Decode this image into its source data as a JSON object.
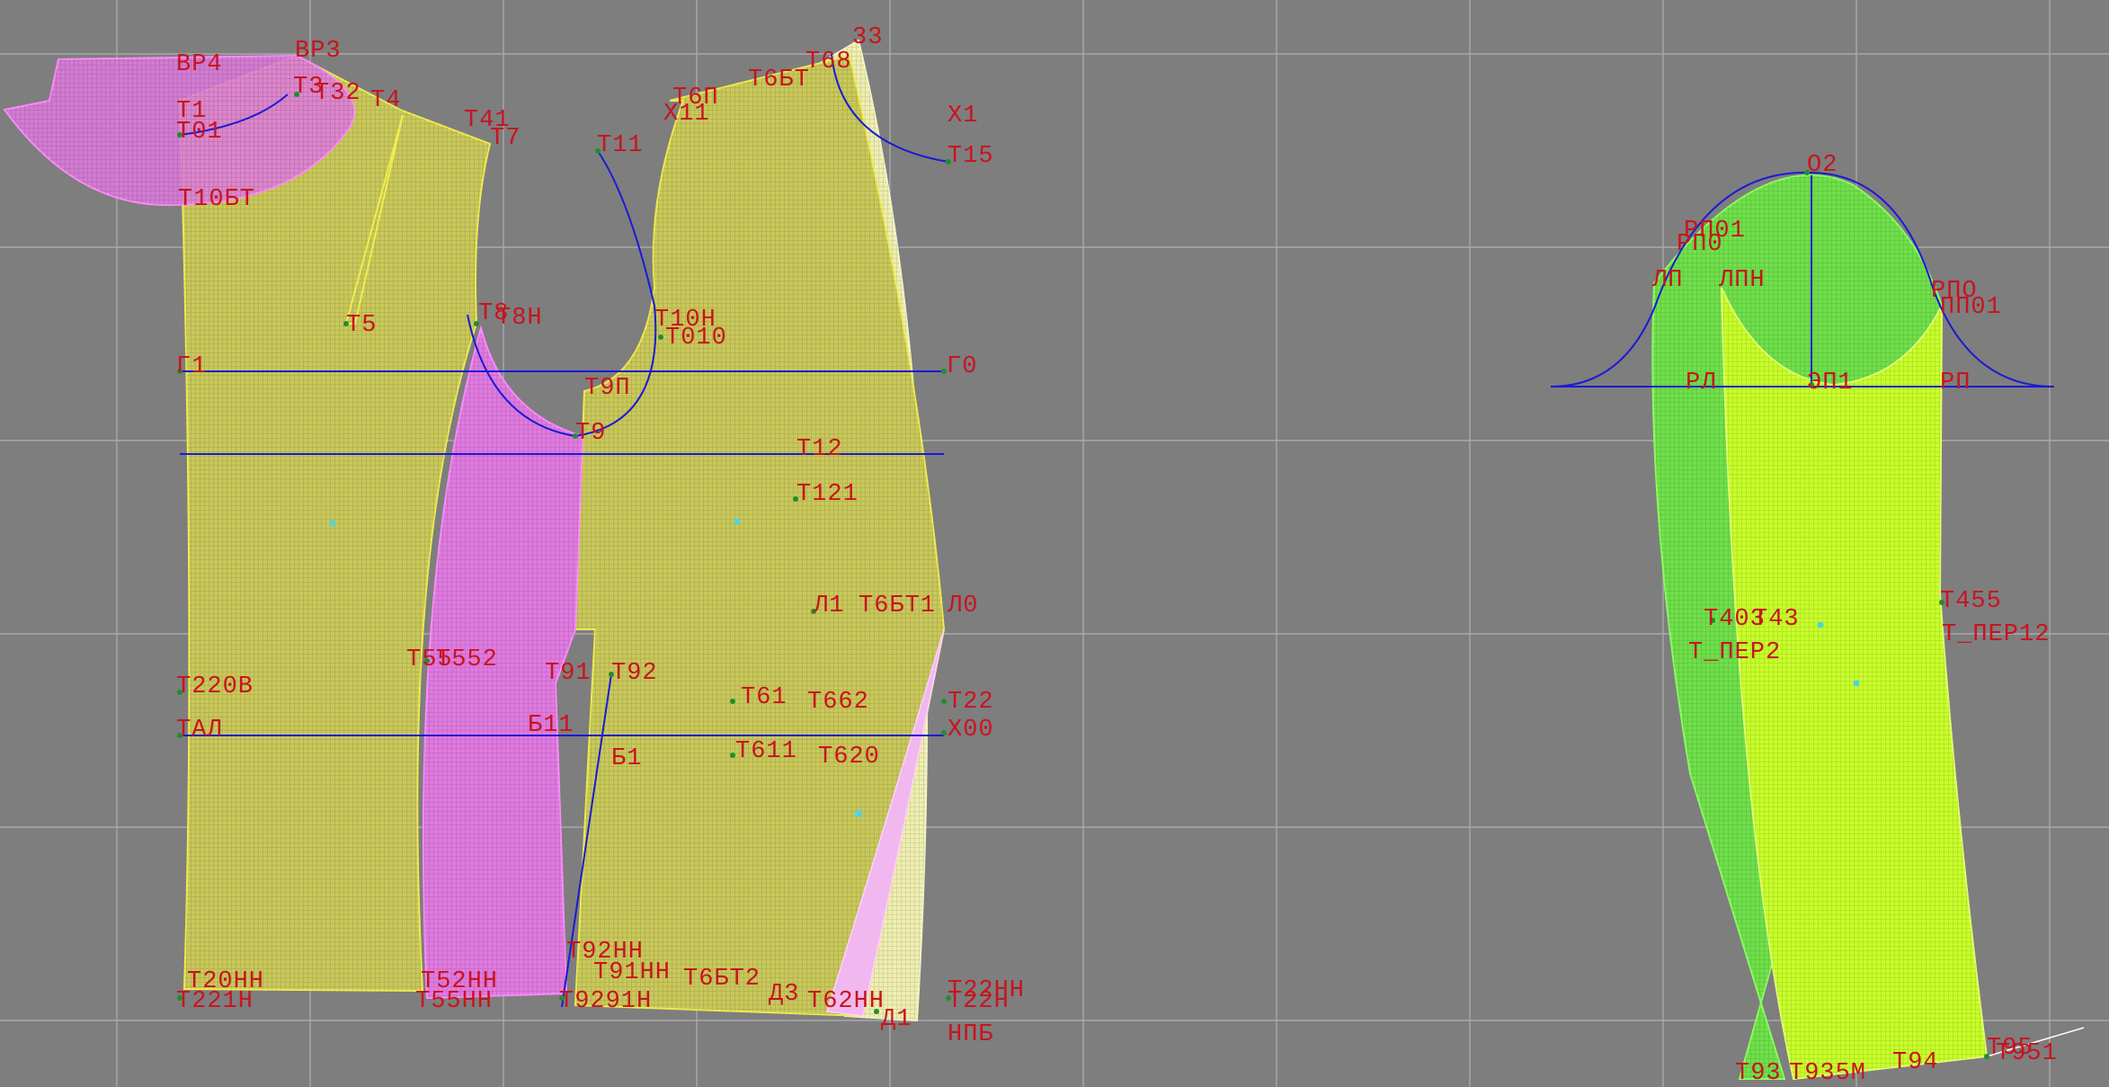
{
  "colors": {
    "background": "#7e7e7e",
    "grid": "#a9a9a9",
    "label": "#c8141e",
    "construction_line": "#1a1ad6",
    "piece_yellow": "#c9c85a",
    "piece_pink": "#e07ae0",
    "piece_pale": "#ecec9e",
    "piece_green": "#6fe04a",
    "piece_lime": "#c8ff2a"
  },
  "labels": {
    "vr4": "ВР4",
    "vr3": "ВР3",
    "t1": "Т1",
    "t01": "Т01",
    "t10bt": "Т10БТ",
    "t3": "Т3",
    "t32": "Т32",
    "t4": "Т4",
    "t41": "Т41",
    "t7": "Т7",
    "t5": "Т5",
    "t11": "Т11",
    "t6p": "Т6П",
    "x11": "Х11",
    "t6bt": "Т6БТ",
    "t68": "Т68",
    "n33": "33",
    "x1": "Х1",
    "t15": "Т15",
    "t8": "Т8",
    "t8n": "Т8Н",
    "t10n": "Т10Н",
    "t010": "Т010",
    "g1": "Г1",
    "g0": "Г0",
    "t9p": "Т9П",
    "t9": "Т9",
    "t12": "Т12",
    "t121": "Т121",
    "l1": "Л1",
    "l0": "Л0",
    "t6bt1": "Т6БТ1",
    "t55": "Т55",
    "t552": "Т552",
    "t220v": "Т220В",
    "t91": "Т91",
    "t92": "Т92",
    "t61": "Т61",
    "t662": "Т662",
    "t22": "Т22",
    "tal": "ТАЛ",
    "b11": "Б11",
    "x00": "Х00",
    "b1": "Б1",
    "t611": "Т611",
    "t620": "Т620",
    "t92nn": "Т92НН",
    "t20nn": "Т20НН",
    "t52nn": "Т52НН",
    "t91nn": "Т91НН",
    "t6bt2": "Т6БТ2",
    "d3": "Д3",
    "t62nn": "Т62НН",
    "t22nn": "Т22НН",
    "t22h": "Т22Н",
    "d1": "Д1",
    "npb": "НПБ",
    "t221n": "Т221Н",
    "t55nn": "Т55НН",
    "t9291n": "Т9291Н",
    "o2": "О2",
    "rp01": "РП01",
    "rp0": "РП0",
    "lp": "ЛП",
    "lpn": "ЛПН",
    "rpo": "РПО",
    "pp01": "ПП01",
    "rl": "РЛ",
    "rp": "РП",
    "e1": "ЭП1",
    "t403": "Т403",
    "t43": "Т43",
    "t455": "Т455",
    "t_per2": "Т_ПЕР2",
    "t_per12": "Т_ПЕР12",
    "t93": "Т93",
    "t935m": "Т935М",
    "t94": "Т94",
    "t95": "Т95",
    "t951": "Т951"
  }
}
